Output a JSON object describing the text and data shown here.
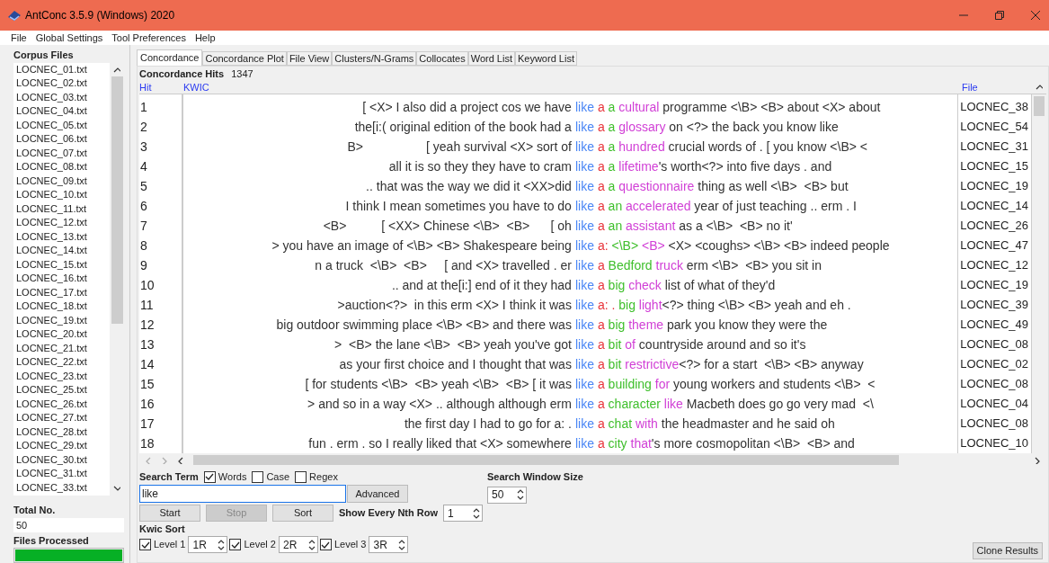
{
  "window": {
    "title": "AntConc 3.5.9 (Windows) 2020"
  },
  "menu": [
    "File",
    "Global Settings",
    "Tool Preferences",
    "Help"
  ],
  "corpus": {
    "title": "Corpus Files",
    "files": [
      "LOCNEC_01.txt",
      "LOCNEC_02.txt",
      "LOCNEC_03.txt",
      "LOCNEC_04.txt",
      "LOCNEC_05.txt",
      "LOCNEC_06.txt",
      "LOCNEC_07.txt",
      "LOCNEC_08.txt",
      "LOCNEC_09.txt",
      "LOCNEC_10.txt",
      "LOCNEC_11.txt",
      "LOCNEC_12.txt",
      "LOCNEC_13.txt",
      "LOCNEC_14.txt",
      "LOCNEC_15.txt",
      "LOCNEC_16.txt",
      "LOCNEC_17.txt",
      "LOCNEC_18.txt",
      "LOCNEC_19.txt",
      "LOCNEC_20.txt",
      "LOCNEC_21.txt",
      "LOCNEC_22.txt",
      "LOCNEC_23.txt",
      "LOCNEC_25.txt",
      "LOCNEC_26.txt",
      "LOCNEC_27.txt",
      "LOCNEC_28.txt",
      "LOCNEC_29.txt",
      "LOCNEC_30.txt",
      "LOCNEC_31.txt",
      "LOCNEC_33.txt"
    ],
    "total_label": "Total No.",
    "total": "50",
    "processed_label": "Files Processed",
    "processed": {
      "level": 1
    }
  },
  "tabs": [
    {
      "label": "Concordance",
      "selected": true
    },
    {
      "label": "Concordance Plot",
      "selected": false
    },
    {
      "label": "File View",
      "selected": false
    },
    {
      "label": "Clusters/N-Grams",
      "selected": false
    },
    {
      "label": "Collocates",
      "selected": false
    },
    {
      "label": "Word List",
      "selected": false
    },
    {
      "label": "Keyword List",
      "selected": false
    }
  ],
  "hits_label": "Concordance Hits",
  "hits": "1347",
  "columns": [
    "Hit",
    "KWIC",
    "File"
  ],
  "rows": [
    {
      "hit": "1",
      "left": "[ <X> I also did a project cos we have",
      "keyword": "like",
      "right": [
        {
          "text": "a",
          "color": "#e8333a"
        },
        {
          "text": " a",
          "color": "#3fbf2c"
        },
        {
          "text": " cultural",
          "color": "#d13fd6"
        },
        {
          "text": " programme <\\B> <B> about <X> about",
          "color": "#333333"
        }
      ],
      "file": "LOCNEC_38"
    },
    {
      "hit": "2",
      "left": "the[i:( original edition of the book had a",
      "keyword": "like",
      "right": [
        {
          "text": "a",
          "color": "#e8333a"
        },
        {
          "text": " a",
          "color": "#3fbf2c"
        },
        {
          "text": " glossary",
          "color": "#d13fd6"
        },
        {
          "text": " on <?> the back you know like",
          "color": "#333333"
        }
      ],
      "file": "LOCNEC_54"
    },
    {
      "hit": "3",
      "left": "B>                  [ yeah survival <X> sort of",
      "keyword": "like",
      "right": [
        {
          "text": "a",
          "color": "#e8333a"
        },
        {
          "text": " a",
          "color": "#3fbf2c"
        },
        {
          "text": " hundred",
          "color": "#d13fd6"
        },
        {
          "text": " crucial words of . [ you know <\\B> <",
          "color": "#333333"
        }
      ],
      "file": "LOCNEC_31"
    },
    {
      "hit": "4",
      "left": "all it is so they they have to cram",
      "keyword": "like",
      "right": [
        {
          "text": "a",
          "color": "#e8333a"
        },
        {
          "text": " a",
          "color": "#3fbf2c"
        },
        {
          "text": " lifetime",
          "color": "#d13fd6"
        },
        {
          "text": "'s worth<?> into five days . and",
          "color": "#333333"
        }
      ],
      "file": "LOCNEC_15"
    },
    {
      "hit": "5",
      "left": ".. that was the way we did it <XX>did",
      "keyword": "like",
      "right": [
        {
          "text": "a",
          "color": "#e8333a"
        },
        {
          "text": " a",
          "color": "#3fbf2c"
        },
        {
          "text": " questionnaire",
          "color": "#d13fd6"
        },
        {
          "text": " thing as well <\\B>  <B> but",
          "color": "#333333"
        }
      ],
      "file": "LOCNEC_19"
    },
    {
      "hit": "6",
      "left": "I think I mean sometimes you have to do",
      "keyword": "like",
      "right": [
        {
          "text": "a",
          "color": "#e8333a"
        },
        {
          "text": " an",
          "color": "#3fbf2c"
        },
        {
          "text": " accelerated",
          "color": "#d13fd6"
        },
        {
          "text": " year of just teaching .. erm . I",
          "color": "#333333"
        }
      ],
      "file": "LOCNEC_14"
    },
    {
      "hit": "7",
      "left": "<B>          [ <XX> Chinese <\\B>  <B>      [ oh",
      "keyword": "like",
      "right": [
        {
          "text": "a",
          "color": "#e8333a"
        },
        {
          "text": " an",
          "color": "#3fbf2c"
        },
        {
          "text": " assistant",
          "color": "#d13fd6"
        },
        {
          "text": " as a <\\B>  <B> no it'",
          "color": "#333333"
        }
      ],
      "file": "LOCNEC_26"
    },
    {
      "hit": "8",
      "left": "> you have an image of <\\B> <B> Shakespeare being",
      "keyword": "like",
      "right": [
        {
          "text": "a:",
          "color": "#e8333a"
        },
        {
          "text": " <\\B>",
          "color": "#3fbf2c"
        },
        {
          "text": " <B>",
          "color": "#d13fd6"
        },
        {
          "text": " <X> <coughs> <\\B> <B> indeed people",
          "color": "#333333"
        }
      ],
      "file": "LOCNEC_47"
    },
    {
      "hit": "9",
      "left": "n a truck  <\\B>  <B>     [ and <X> travelled . er",
      "keyword": "like",
      "right": [
        {
          "text": "a",
          "color": "#e8333a"
        },
        {
          "text": " Bedford",
          "color": "#3fbf2c"
        },
        {
          "text": " truck",
          "color": "#d13fd6"
        },
        {
          "text": " erm <\\B>  <B> you sit in",
          "color": "#333333"
        }
      ],
      "file": "LOCNEC_12"
    },
    {
      "hit": "10",
      "left": ".. and at the[i:] end of it they had",
      "keyword": "like",
      "right": [
        {
          "text": "a",
          "color": "#e8333a"
        },
        {
          "text": " big",
          "color": "#3fbf2c"
        },
        {
          "text": " check",
          "color": "#d13fd6"
        },
        {
          "text": " list of what of they'd",
          "color": "#333333"
        }
      ],
      "file": "LOCNEC_19"
    },
    {
      "hit": "11",
      "left": ">auction<?>  in this erm <X> I think it was",
      "keyword": "like",
      "right": [
        {
          "text": "a: .",
          "color": "#e8333a"
        },
        {
          "text": " big",
          "color": "#3fbf2c"
        },
        {
          "text": " light",
          "color": "#d13fd6"
        },
        {
          "text": "<?> thing <\\B> <B> yeah and eh .",
          "color": "#333333"
        }
      ],
      "file": "LOCNEC_39"
    },
    {
      "hit": "12",
      "left": "big outdoor swimming place <\\B> <B> and there was",
      "keyword": "like",
      "right": [
        {
          "text": "a",
          "color": "#e8333a"
        },
        {
          "text": " big",
          "color": "#3fbf2c"
        },
        {
          "text": " theme",
          "color": "#d13fd6"
        },
        {
          "text": " park you know they were the",
          "color": "#333333"
        }
      ],
      "file": "LOCNEC_49"
    },
    {
      "hit": "13",
      "left": ">  <B> the lane <\\B>  <B> yeah you've got",
      "keyword": "like",
      "right": [
        {
          "text": "a",
          "color": "#e8333a"
        },
        {
          "text": " bit",
          "color": "#3fbf2c"
        },
        {
          "text": " of",
          "color": "#d13fd6"
        },
        {
          "text": " countryside around and so it's",
          "color": "#333333"
        }
      ],
      "file": "LOCNEC_08"
    },
    {
      "hit": "14",
      "left": "as your first choice and I thought that was",
      "keyword": "like",
      "right": [
        {
          "text": "a",
          "color": "#e8333a"
        },
        {
          "text": " bit",
          "color": "#3fbf2c"
        },
        {
          "text": " restrictive",
          "color": "#d13fd6"
        },
        {
          "text": "<?> for a start  <\\B> <B> anyway",
          "color": "#333333"
        }
      ],
      "file": "LOCNEC_02"
    },
    {
      "hit": "15",
      "left": "[ for students <\\B>  <B> yeah <\\B>  <B> [ it was",
      "keyword": "like",
      "right": [
        {
          "text": "a",
          "color": "#e8333a"
        },
        {
          "text": " building",
          "color": "#3fbf2c"
        },
        {
          "text": " for",
          "color": "#d13fd6"
        },
        {
          "text": " young workers and students <\\B>  <",
          "color": "#333333"
        }
      ],
      "file": "LOCNEC_08"
    },
    {
      "hit": "16",
      "left": "> and so in a way <X> .. although although erm",
      "keyword": "like",
      "right": [
        {
          "text": "a",
          "color": "#e8333a"
        },
        {
          "text": " character",
          "color": "#3fbf2c"
        },
        {
          "text": " like",
          "color": "#d13fd6"
        },
        {
          "text": " Macbeth does go go very mad  <\\",
          "color": "#333333"
        }
      ],
      "file": "LOCNEC_04"
    },
    {
      "hit": "17",
      "left": "the first day I had to go for a: .",
      "keyword": "like",
      "right": [
        {
          "text": "a",
          "color": "#e8333a"
        },
        {
          "text": " chat",
          "color": "#3fbf2c"
        },
        {
          "text": " with",
          "color": "#d13fd6"
        },
        {
          "text": " the headmaster and he said oh",
          "color": "#333333"
        }
      ],
      "file": "LOCNEC_08"
    },
    {
      "hit": "18",
      "left": "fun . erm . so I really liked that <X> somewhere",
      "keyword": "like",
      "right": [
        {
          "text": "a",
          "color": "#e8333a"
        },
        {
          "text": " city",
          "color": "#3fbf2c"
        },
        {
          "text": " that",
          "color": "#d13fd6"
        },
        {
          "text": "'s more cosmopolitan <\\B>  <B> and",
          "color": "#333333"
        }
      ],
      "file": "LOCNEC_10"
    }
  ],
  "search": {
    "label": "Search Term",
    "options": [
      {
        "label": "Words",
        "checked": true
      },
      {
        "label": "Case",
        "checked": false
      },
      {
        "label": "Regex",
        "checked": false
      }
    ],
    "value": "like",
    "advanced": "Advanced"
  },
  "buttons": [
    {
      "label": "Start",
      "disabled": false
    },
    {
      "label": "Stop",
      "disabled": true
    },
    {
      "label": "Sort",
      "disabled": false
    }
  ],
  "nth_row": {
    "label": "Show Every Nth Row",
    "value": "1"
  },
  "window_size": {
    "label": "Search Window Size",
    "value": "50"
  },
  "kwic_sort": {
    "label": "Kwic Sort",
    "levels": [
      {
        "label": "Level 1",
        "checked": true,
        "value": "1R"
      },
      {
        "label": "Level 2",
        "checked": true,
        "value": "2R"
      },
      {
        "label": "Level 3",
        "checked": true,
        "value": "3R"
      }
    ]
  },
  "clone": "Clone Results"
}
